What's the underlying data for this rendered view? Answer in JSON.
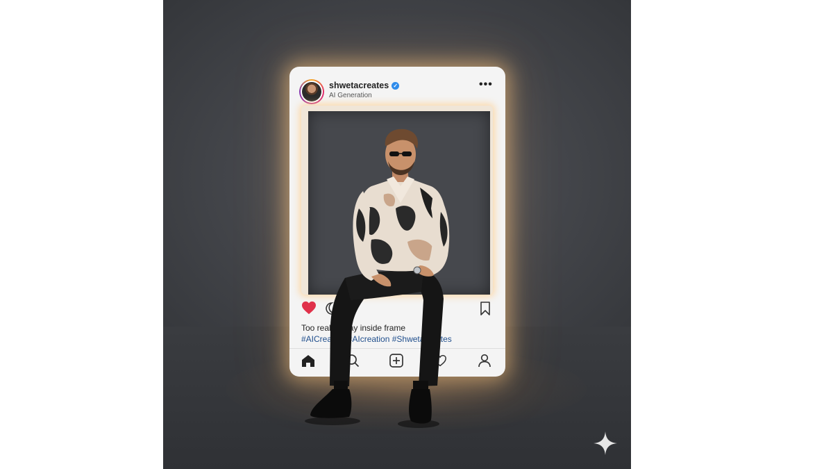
{
  "post": {
    "username": "shwetacreates",
    "subtitle": "AI Generation",
    "caption": "Too real to stay inside frame",
    "hashtags": "#AICreation #AIcreation #Shwetacreates"
  },
  "icons": {
    "more": "more-options-icon",
    "verified": "verified-badge-icon",
    "like": "heart-icon",
    "comment": "comment-icon",
    "save": "bookmark-icon",
    "home": "home-icon",
    "search": "search-icon",
    "create": "create-post-icon",
    "activity": "activity-heart-icon",
    "profile": "profile-icon",
    "watermark": "sparkle-icon"
  },
  "colors": {
    "like_active": "#e0314a",
    "verified": "#2f8ceb",
    "hashtag": "#1f4e8c",
    "glow": "#ffc88a"
  },
  "state": {
    "liked": true
  }
}
